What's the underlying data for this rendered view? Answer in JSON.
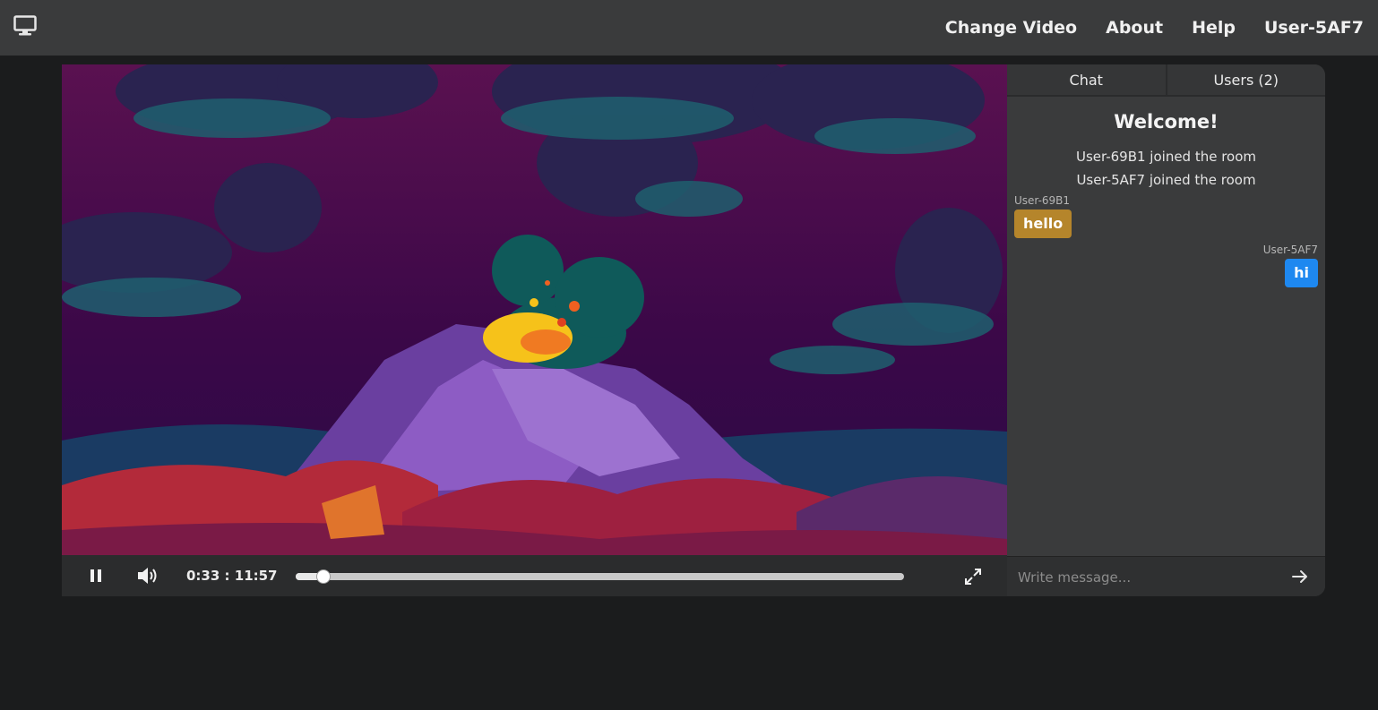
{
  "nav": {
    "items": [
      "Change Video",
      "About",
      "Help",
      "User-5AF7"
    ]
  },
  "player": {
    "time": "0:33 : 11:57",
    "progress": 0.046
  },
  "sidebar": {
    "tabs": [
      "Chat",
      "Users (2)"
    ],
    "welcome": "Welcome!",
    "system_messages": [
      "User-69B1 joined the room",
      "User-5AF7 joined the room"
    ],
    "messages": [
      {
        "user": "User-69B1",
        "text": "hello",
        "color": "#b5852b",
        "side": "left"
      },
      {
        "user": "User-5AF7",
        "text": "hi",
        "color": "#1e88f0",
        "side": "right"
      }
    ],
    "input_placeholder": "Write message..."
  },
  "icons": {
    "logo": "monitor-icon",
    "pause": "pause-icon",
    "volume": "volume-icon",
    "fullscreen": "fullscreen-icon",
    "send": "arrow-right-icon"
  }
}
